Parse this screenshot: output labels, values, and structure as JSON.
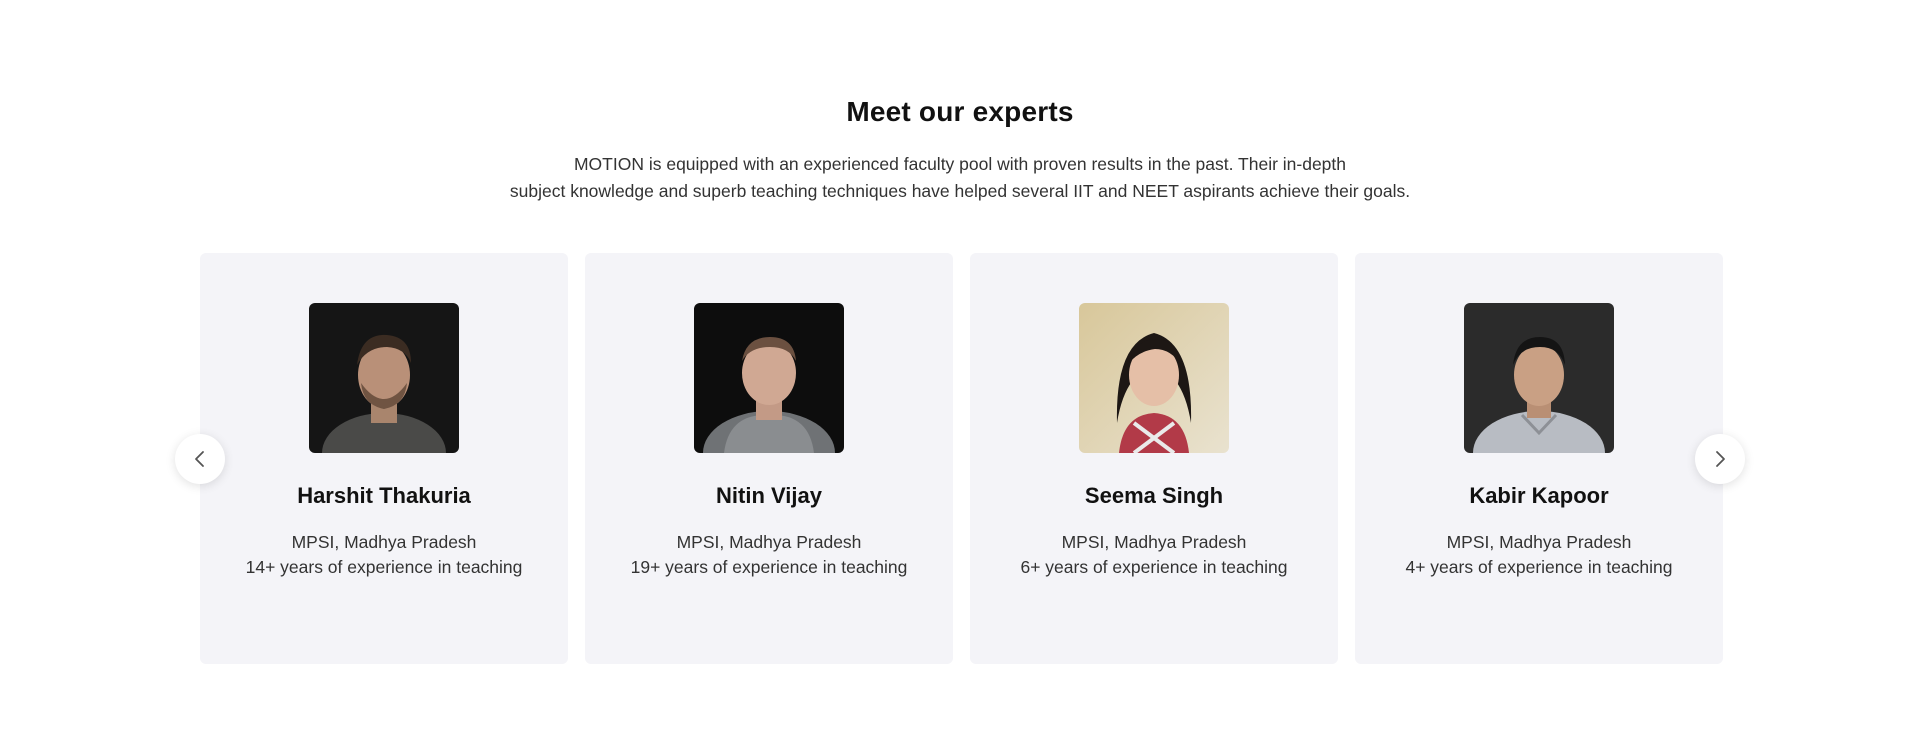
{
  "section": {
    "title": "Meet our experts",
    "description_line1": "MOTION is equipped with an experienced faculty pool with proven results in the past. Their in-depth",
    "description_line2": "subject knowledge and superb teaching techniques have helped several IIT and NEET aspirants achieve their goals."
  },
  "experts": [
    {
      "name": "Harshit Thakuria",
      "org": "MPSI, Madhya Pradesh",
      "experience": "14+ years of experience in teaching"
    },
    {
      "name": "Nitin Vijay",
      "org": "MPSI, Madhya Pradesh",
      "experience": "19+ years of experience in teaching"
    },
    {
      "name": "Seema Singh",
      "org": "MPSI, Madhya Pradesh",
      "experience": "6+ years of experience in teaching"
    },
    {
      "name": "Kabir Kapoor",
      "org": "MPSI, Madhya Pradesh",
      "experience": "4+ years of experience in teaching"
    }
  ],
  "controls": {
    "prev_icon": "chevron-left-icon",
    "next_icon": "chevron-right-icon"
  },
  "colors": {
    "card_background": "#f4f4f8",
    "heading": "#111111",
    "body_text": "#333333"
  }
}
